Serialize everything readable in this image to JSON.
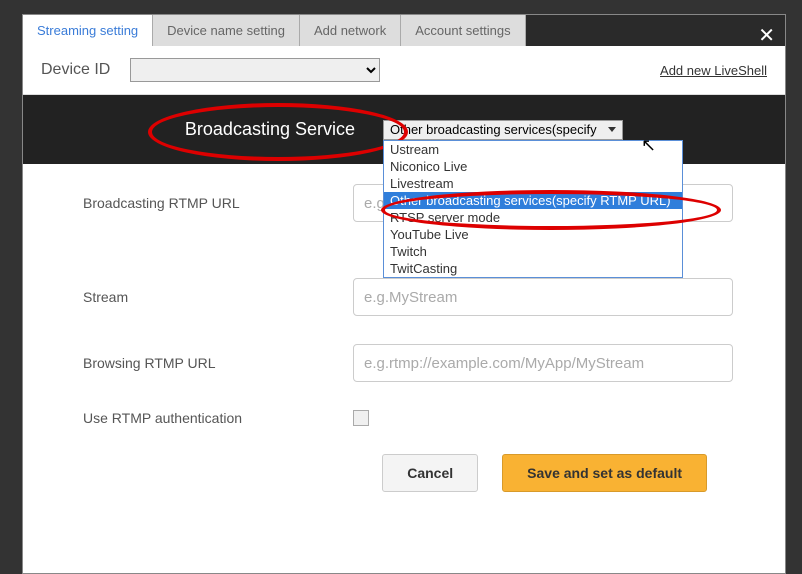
{
  "tabs": {
    "streaming": "Streaming setting",
    "device_name": "Device name setting",
    "add_network": "Add network",
    "account": "Account settings"
  },
  "device_row": {
    "label": "Device ID",
    "add_link": "Add new LiveShell"
  },
  "service": {
    "label": "Broadcasting Service",
    "selected": "Other broadcasting services(specify",
    "options": {
      "0": "Ustream",
      "1": "Niconico Live",
      "2": "Livestream",
      "3": "Other broadcasting services(specify RTMP URL)",
      "4": "RTSP server mode",
      "5": "YouTube Live",
      "6": "Twitch",
      "7": "TwitCasting"
    }
  },
  "form": {
    "rtmp_url_label": "Broadcasting RTMP URL",
    "rtmp_url_placeholder": "e.g.",
    "stream_label": "Stream",
    "stream_placeholder": "e.g.MyStream",
    "browsing_label": "Browsing RTMP URL",
    "browsing_placeholder": "e.g.rtmp://example.com/MyApp/MyStream",
    "auth_label": "Use RTMP authentication"
  },
  "buttons": {
    "cancel": "Cancel",
    "save": "Save and set as default"
  }
}
